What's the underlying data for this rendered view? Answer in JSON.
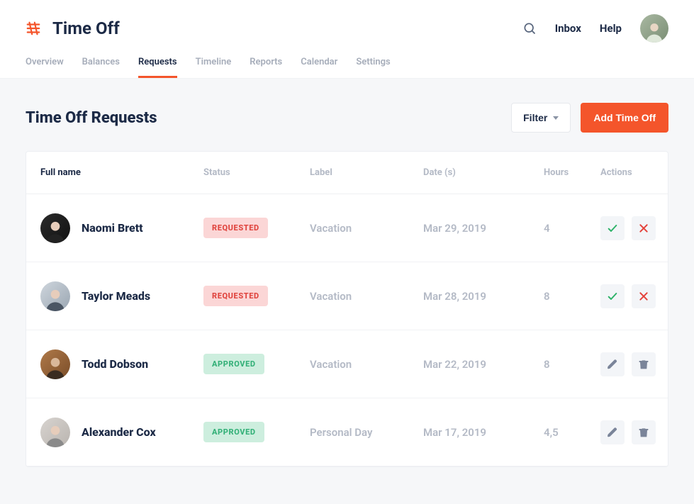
{
  "header": {
    "app_title": "Time Off",
    "links": {
      "inbox": "Inbox",
      "help": "Help"
    }
  },
  "tabs": [
    {
      "label": "Overview",
      "active": false
    },
    {
      "label": "Balances",
      "active": false
    },
    {
      "label": "Requests",
      "active": true
    },
    {
      "label": "Timeline",
      "active": false
    },
    {
      "label": "Reports",
      "active": false
    },
    {
      "label": "Calendar",
      "active": false
    },
    {
      "label": "Settings",
      "active": false
    }
  ],
  "page": {
    "title": "Time Off Requests",
    "filter_label": "Filter",
    "add_label": "Add Time Off"
  },
  "table": {
    "columns": {
      "name": "Full name",
      "status": "Status",
      "label": "Label",
      "date": "Date (s)",
      "hours": "Hours",
      "actions": "Actions"
    },
    "rows": [
      {
        "name": "Naomi Brett",
        "status": "REQUESTED",
        "status_kind": "requested",
        "label": "Vacation",
        "date": "Mar 29, 2019",
        "hours": "4",
        "action_set": "review"
      },
      {
        "name": "Taylor Meads",
        "status": "REQUESTED",
        "status_kind": "requested",
        "label": "Vacation",
        "date": "Mar 28, 2019",
        "hours": "8",
        "action_set": "review"
      },
      {
        "name": "Todd Dobson",
        "status": "APPROVED",
        "status_kind": "approved",
        "label": "Vacation",
        "date": "Mar 22, 2019",
        "hours": "8",
        "action_set": "manage"
      },
      {
        "name": "Alexander Cox",
        "status": "APPROVED",
        "status_kind": "approved",
        "label": "Personal Day",
        "date": "Mar 17, 2019",
        "hours": "4,5",
        "action_set": "manage"
      }
    ]
  },
  "colors": {
    "accent": "#f4552b",
    "status_requested_bg": "#fbd6d6",
    "status_requested_fg": "#e0453f",
    "status_approved_bg": "#cdeede",
    "status_approved_fg": "#35b179"
  }
}
